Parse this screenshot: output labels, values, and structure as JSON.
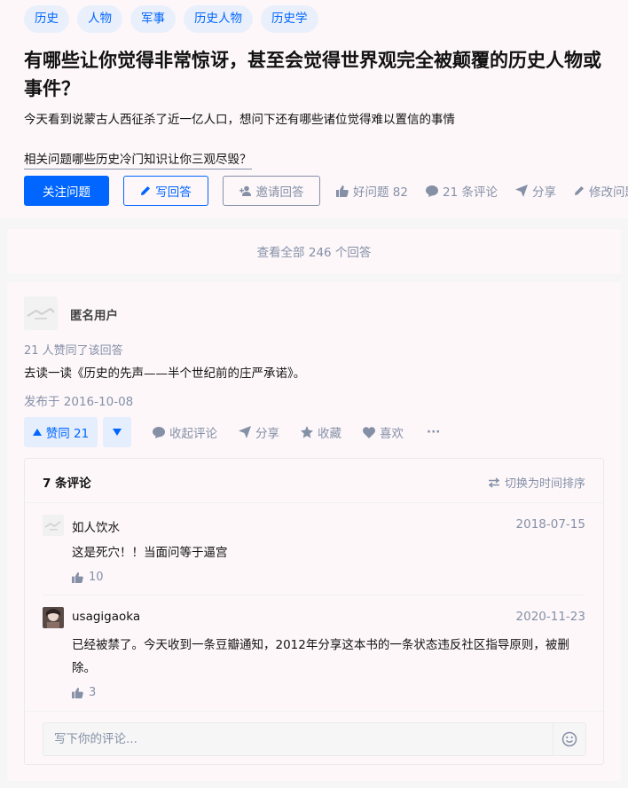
{
  "question": {
    "tags": [
      "历史",
      "人物",
      "军事",
      "历史人物",
      "历史学"
    ],
    "title": "有哪些让你觉得非常惊讶，甚至会觉得世界观完全被颠覆的历史人物或事件？",
    "description": "今天看到说蒙古人西征杀了近一亿人口，想问下还有哪些诸位觉得难以置信的事情",
    "related": "相关问题哪些历史冷门知识让你三观尽毁？",
    "actions": {
      "follow": "关注问题",
      "write": "写回答",
      "invite": "邀请回答",
      "good": "好问题 82",
      "comments": "21 条评论",
      "share": "分享",
      "edit": "修改问题"
    }
  },
  "view_all": "查看全部 246 个回答",
  "answer": {
    "author": "匿名用户",
    "votes_note": "21 人赞同了该回答",
    "content": "去读一读《历史的先声——半个世纪前的庄严承诺》。",
    "published": "发布于 2016-10-08",
    "actions": {
      "upvote": "赞同 21",
      "collapse_comments": "收起评论",
      "share": "分享",
      "favorite": "收藏",
      "like": "喜欢",
      "more": "···"
    }
  },
  "comments": {
    "count": "7 条评论",
    "sort": "切换为时间排序",
    "items": [
      {
        "name": "如人饮水",
        "date": "2018-07-15",
        "text": "这是死穴！！当面问等于逼宫",
        "likes": "10"
      },
      {
        "name": "usagigaoka",
        "date": "2020-11-23",
        "text": "已经被禁了。今天收到一条豆瓣通知，2012年分享这本书的一条状态违反社区指导原则，被删除。",
        "likes": "3"
      }
    ],
    "input_placeholder": "写下你的评论..."
  },
  "colors": {
    "accent": "#0066ff",
    "muted": "#8590a6",
    "panel": "#fdf7fa"
  },
  "icons": [
    "pen-icon",
    "invite-icon",
    "thumb-up-icon",
    "comment-icon",
    "share-icon",
    "edit-icon",
    "triangle-up-icon",
    "triangle-down-icon",
    "star-icon",
    "heart-icon",
    "sort-icon",
    "emoji-icon"
  ]
}
